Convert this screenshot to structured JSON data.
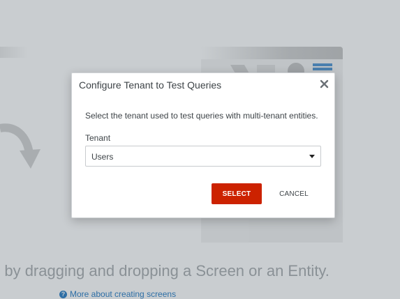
{
  "dialog": {
    "title": "Configure Tenant to Test Queries",
    "description": "Select the tenant used to test queries with multi-tenant entities.",
    "tenant_label": "Tenant",
    "tenant_value": "Users",
    "select_button": "SELECT",
    "cancel_button": "CANCEL",
    "close_icon": "close-icon"
  },
  "background": {
    "instruction": "n by dragging and dropping a Screen or an Entity.",
    "help_link": "More about creating screens",
    "help_icon": "question-circle-icon"
  },
  "colors": {
    "primary_button": "#cc2200",
    "overlay": "#c9cdd0",
    "link": "#2e6fa6"
  }
}
